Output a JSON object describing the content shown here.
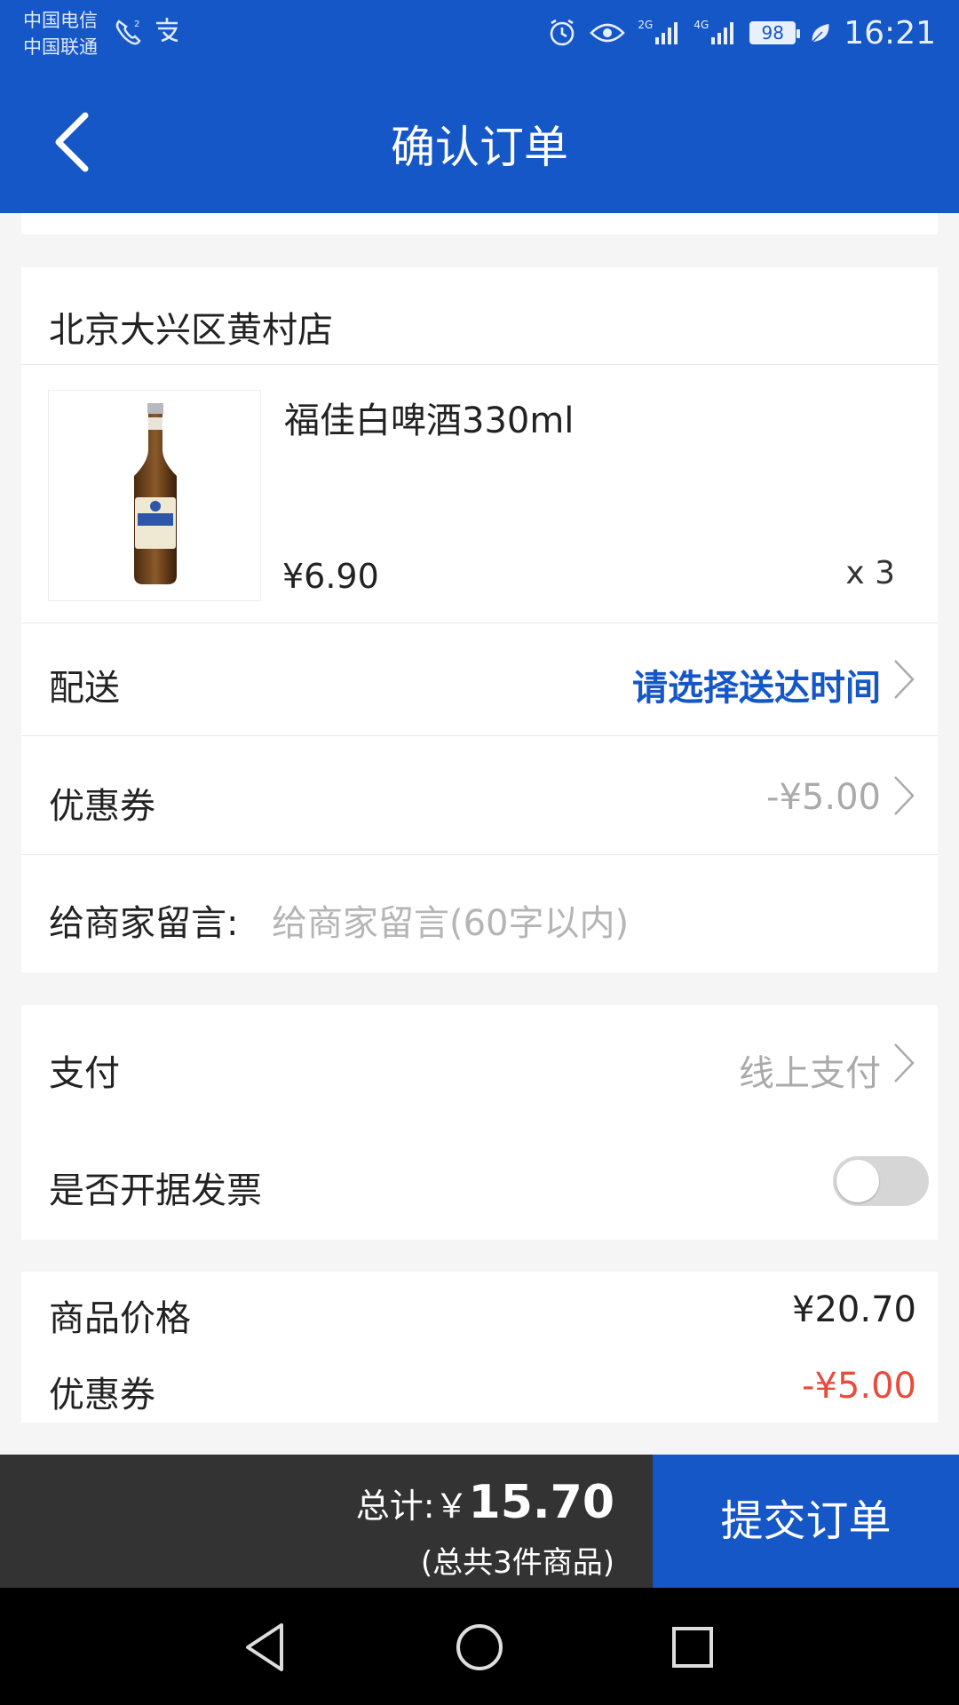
{
  "status_bar": {
    "carrier_1": "中国电信",
    "carrier_2": "中国联通",
    "net_1": "2G",
    "net_2": "4G",
    "battery": "98",
    "time": "16:21"
  },
  "header": {
    "title": "确认订单"
  },
  "store": {
    "name": "北京大兴区黄村店"
  },
  "product": {
    "name": "福佳白啤酒330ml",
    "price": "¥6.90",
    "quantity": "x 3",
    "image_icon": "beer-bottle-icon"
  },
  "delivery": {
    "label": "配送",
    "value": "请选择送达时间"
  },
  "coupon": {
    "label": "优惠券",
    "value": "-¥5.00"
  },
  "message": {
    "label": "给商家留言:",
    "placeholder": "给商家留言(60字以内)"
  },
  "payment": {
    "label": "支付",
    "value": "线上支付"
  },
  "invoice": {
    "label": "是否开据发票",
    "enabled": false
  },
  "summary": {
    "goods_label": "商品价格",
    "goods_value": "¥20.70",
    "coupon_label": "优惠券",
    "coupon_value": "-¥5.00"
  },
  "footer": {
    "total_prefix": "总计:￥",
    "total_amount": "15.70",
    "item_count": "(总共3件商品)",
    "submit_label": "提交订单"
  },
  "colors": {
    "brand_blue": "#1657c8",
    "discount_red": "#e84c3d",
    "muted_gray": "#aaaaaa"
  }
}
